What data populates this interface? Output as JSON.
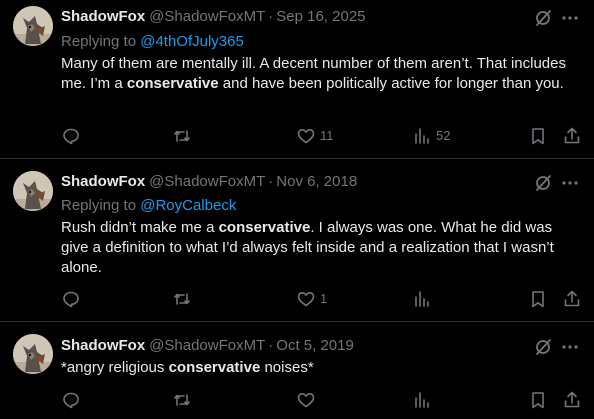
{
  "colors": {
    "background": "#000000",
    "text": "#e7e9ea",
    "muted": "#71767b",
    "link": "#1d9bf0",
    "divider": "#2f3336"
  },
  "tweets": [
    {
      "display_name": "ShadowFox",
      "handle": "@ShadowFoxMT",
      "separator": "·",
      "date": "Sep 16, 2025",
      "replying_prefix": "Replying to",
      "replying_to": "@4thOfJuly365",
      "text_parts": [
        "Many of them are mentally ill.  A decent number of them aren’t.  That includes me.  I’m a ",
        "conservative",
        " and have been politically active for longer than you."
      ],
      "reply_count": "",
      "repost_count": "",
      "like_count": "11",
      "view_count": "52",
      "icons": [
        "grok-icon",
        "more-icon",
        "reply-icon",
        "repost-icon",
        "like-icon",
        "views-icon",
        "bookmark-icon",
        "share-icon"
      ]
    },
    {
      "display_name": "ShadowFox",
      "handle": "@ShadowFoxMT",
      "separator": "·",
      "date": "Nov 6, 2018",
      "replying_prefix": "Replying to",
      "replying_to": "@RoyCalbeck",
      "text_parts": [
        "Rush didn’t make me a ",
        "conservative",
        ". I always was one.  What he did was give a definition to what I’d always felt inside and a realization that I wasn’t alone."
      ],
      "reply_count": "",
      "repost_count": "",
      "like_count": "1",
      "view_count": "",
      "icons": [
        "grok-icon",
        "more-icon",
        "reply-icon",
        "repost-icon",
        "like-icon",
        "views-icon",
        "bookmark-icon",
        "share-icon"
      ]
    },
    {
      "display_name": "ShadowFox",
      "handle": "@ShadowFoxMT",
      "separator": "·",
      "date": "Oct 5, 2019",
      "text_parts": [
        "*angry religious ",
        "conservative",
        " noises*"
      ],
      "reply_count": "",
      "repost_count": "",
      "like_count": "",
      "view_count": "",
      "icons": [
        "grok-icon",
        "more-icon",
        "reply-icon",
        "repost-icon",
        "like-icon",
        "views-icon",
        "bookmark-icon",
        "share-icon"
      ]
    }
  ]
}
